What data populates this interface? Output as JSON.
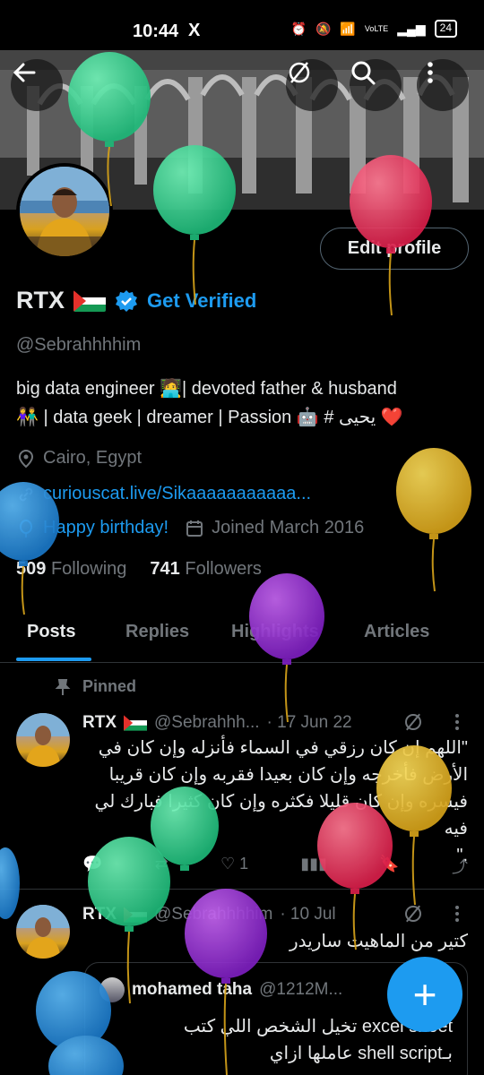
{
  "status_bar": {
    "time": "10:44",
    "app_icon": "X",
    "battery": "24",
    "network": "VoLTE"
  },
  "header": {
    "back_icon": "arrow-left-icon",
    "grok_icon": "grok-icon",
    "search_icon": "search-icon",
    "more_icon": "more-vertical-icon"
  },
  "profile": {
    "edit_label": "Edit profile",
    "name": "RTX",
    "get_verified": "Get Verified",
    "handle": "@Sebrahhhhim",
    "bio_line1": "big data engineer 🧑‍💻| devoted father & husband",
    "bio_line2": "👫 | data geek | dreamer | Passion 🤖 # يحيى ❤️",
    "location": "Cairo, Egypt",
    "website": "curiouscat.live/Sikaaaaaaaaaaa...",
    "birthday": "Happy birthday!",
    "joined": "Joined March 2016",
    "following_count": "509",
    "following_label": "Following",
    "followers_count": "741",
    "followers_label": "Followers"
  },
  "tabs": [
    "Posts",
    "Replies",
    "Highlights",
    "Articles"
  ],
  "pinned_label": "Pinned",
  "tweets": [
    {
      "name": "RTX",
      "handle": "@Sebrahhh...",
      "date": "· 17 Jun 22",
      "text_line1": "\"اللهم إن كان رزقي في السماء فأنزله وإن كان في",
      "text_line2": "الأرض فأخرجه وإن كان بعيدا فقربه وإن كان قريبا",
      "text_line3": "فيسره وإن كان قليلا فكثره وإن كان كثيرا فبارك لي فيه",
      "text_line4": ".\"",
      "likes": "1"
    },
    {
      "name": "RTX",
      "handle": "@Sebrahhhhim",
      "date": "· 10 Jul",
      "text_line1": "كتير من الماهيت ساريدر",
      "quote_name": "mohamed taha",
      "quote_handle": "@1212M...",
      "quote_line1": "excel sheet تخيل الشخص اللي كتب",
      "quote_line2": "بـshell script عاملها ازاي"
    }
  ],
  "fab_label": "+",
  "colors": {
    "accent": "#1d9bf0",
    "bg": "#000000",
    "muted": "#71767b",
    "text": "#e7e9ea"
  }
}
